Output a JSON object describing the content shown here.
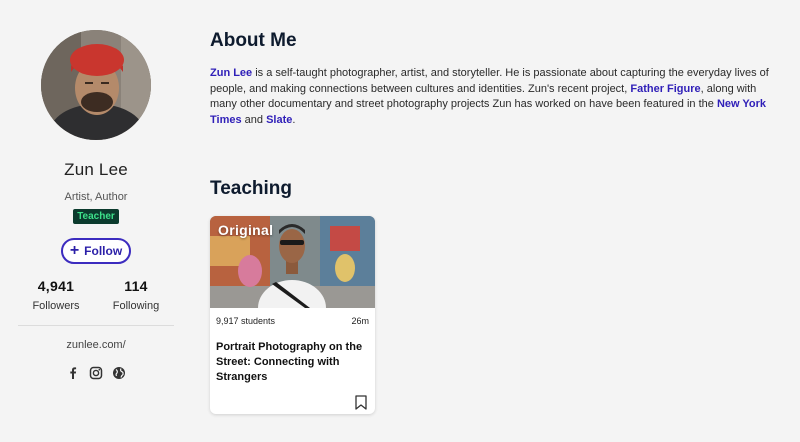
{
  "profile": {
    "name": "Zun Lee",
    "title": "Artist, Author",
    "badge": "Teacher",
    "follow_label": "Follow",
    "followers_count": "4,941",
    "followers_label": "Followers",
    "following_count": "114",
    "following_label": "Following",
    "website": "zunlee.com/",
    "social_icons": [
      "facebook-icon",
      "instagram-icon",
      "globe-icon"
    ]
  },
  "about": {
    "heading": "About Me",
    "name_link": "Zun Lee",
    "text1": " is a self-taught photographer, artist, and storyteller. He is passionate about capturing the everyday lives of people, and making connections between cultures and identities. Zun's recent project, ",
    "project_link": "Father Figure",
    "text2": ", along with many other documentary and street photography projects Zun has worked on have been featured in the ",
    "nyt_link": "New York Times",
    "text3": " and ",
    "slate_link": "Slate",
    "text4": "."
  },
  "teaching": {
    "heading": "Teaching",
    "card": {
      "tag": "Original",
      "students": "9,917 students",
      "duration": "26m",
      "title": "Portrait Photography on the Street: Connecting with Strangers"
    }
  },
  "colors": {
    "accent": "#3c2cbf",
    "badge_bg": "#0b3a2d",
    "badge_text": "#3de08a",
    "heading": "#0e1b2e"
  }
}
